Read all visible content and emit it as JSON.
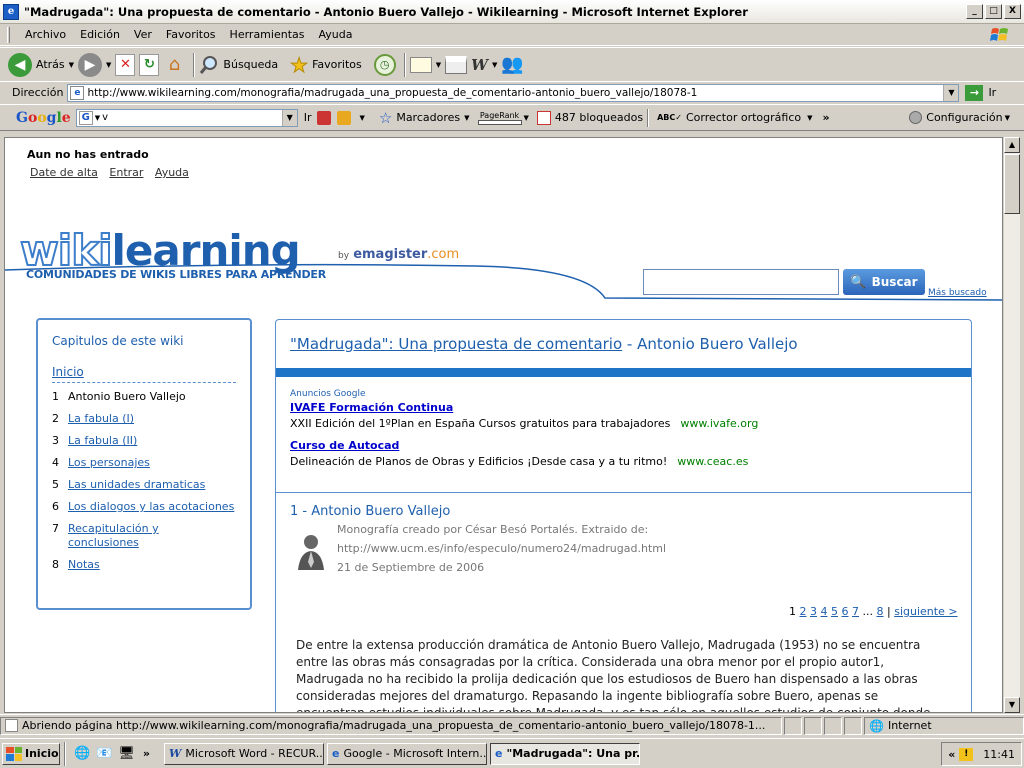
{
  "window": {
    "title": "\"Madrugada\": Una propuesta de comentario - Antonio Buero Vallejo - Wikilearning - Microsoft Internet Explorer",
    "minimize": "_",
    "maximize": "□",
    "close": "X"
  },
  "menu": [
    "Archivo",
    "Edición",
    "Ver",
    "Favoritos",
    "Herramientas",
    "Ayuda"
  ],
  "toolbar": {
    "back": "Atrás",
    "search": "Búsqueda",
    "favorites": "Favoritos"
  },
  "address": {
    "label": "Dirección",
    "url": "http://www.wikilearning.com/monografia/madrugada_una_propuesta_de_comentario-antonio_buero_vallejo/18078-1",
    "go": "Ir"
  },
  "googlebar": {
    "logo": "Google",
    "query": "v",
    "go": "Ir",
    "bookmarks": "Marcadores",
    "pagerank": "PageRank",
    "blocked": "487 bloqueados",
    "spell": "Corrector ortográfico",
    "config": "Configuración"
  },
  "page": {
    "user": {
      "greeting": "Aun no has entrado",
      "signup": "Date de alta",
      "login": "Entrar",
      "help": "Ayuda"
    },
    "logo": {
      "wiki": "wiki",
      "learning": "learning",
      "tagline": "COMUNIDADES DE WIKIS LIBRES PARA APRENDER",
      "by": "by",
      "emagister": "emagister",
      "com": ".com"
    },
    "search": {
      "button": "Buscar",
      "most": "Más buscado"
    },
    "sidebar": {
      "title": "Capitulos de este wiki",
      "home": "Inicio",
      "chapters": [
        {
          "num": "1",
          "label": "Antonio Buero Vallejo"
        },
        {
          "num": "2",
          "label": "La fabula (I)"
        },
        {
          "num": "3",
          "label": "La fabula (II)"
        },
        {
          "num": "4",
          "label": "Los personajes"
        },
        {
          "num": "5",
          "label": "Las unidades dramaticas"
        },
        {
          "num": "6",
          "label": "Los dialogos y las acotaciones"
        },
        {
          "num": "7",
          "label": "Recapitulación y conclusiones"
        },
        {
          "num": "8",
          "label": "Notas"
        }
      ]
    },
    "article": {
      "title_link": "\"Madrugada\": Una propuesta de comentario",
      "title_rest": " - Antonio Buero Vallejo",
      "ads_label": "Anuncios Google",
      "ads": [
        {
          "title": "IVAFE Formación Continua",
          "desc": "XXII Edición del 1ºPlan en España Cursos gratuitos para trabajadores",
          "url": "www.ivafe.org"
        },
        {
          "title": "Curso de Autocad",
          "desc": "Delineación de Planos de Obras y Edificios ¡Desde casa y a tu ritmo!",
          "url": "www.ceac.es"
        }
      ],
      "section": "1 - Antonio Buero Vallejo",
      "meta_line1": "Monografía creado por César Besó Portalés. Extraido de:",
      "meta_line2": "http://www.ucm.es/info/especulo/numero24/madrugad.html",
      "meta_date": "21 de Septiembre de 2006",
      "pager": {
        "current": "1",
        "pages": [
          "2",
          "3",
          "4",
          "5",
          "6",
          "7"
        ],
        "ellipsis": "...",
        "last": "8",
        "sep": "|",
        "next": "siguiente >"
      },
      "body": "De entre la extensa producción dramática de Antonio Buero Vallejo, Madrugada (1953) no se encuentra entre las obras más consagradas por la crítica. Considerada una obra menor por el propio autor1, Madrugada no ha recibido la prolija dedicación que los estudiosos de Buero han dispensado a las obras consideradas mejores del dramaturgo. Repasando la ingente bibliografía sobre Buero, apenas se encuentran estudios individuales sobre Madrugada, y es tan sólo en aquellos estudios de conjunto donde podemos encontrar un acercamiento crítico a"
    }
  },
  "status": {
    "message": "Abriendo página http://www.wikilearning.com/monografia/madrugada_una_propuesta_de_comentario-antonio_buero_vallejo/18078-1...",
    "zone": "Internet"
  },
  "taskbar": {
    "start": "Inicio",
    "chevron": "»",
    "tasks": [
      {
        "label": "Microsoft Word - RECUR..."
      },
      {
        "label": "Google - Microsoft Intern..."
      },
      {
        "label": "\"Madrugada\": Una pr..."
      }
    ],
    "clock": "11:41"
  },
  "colors": {
    "accent": "#1e5fae",
    "bar": "#1f74c7",
    "ad_url": "#008000"
  }
}
